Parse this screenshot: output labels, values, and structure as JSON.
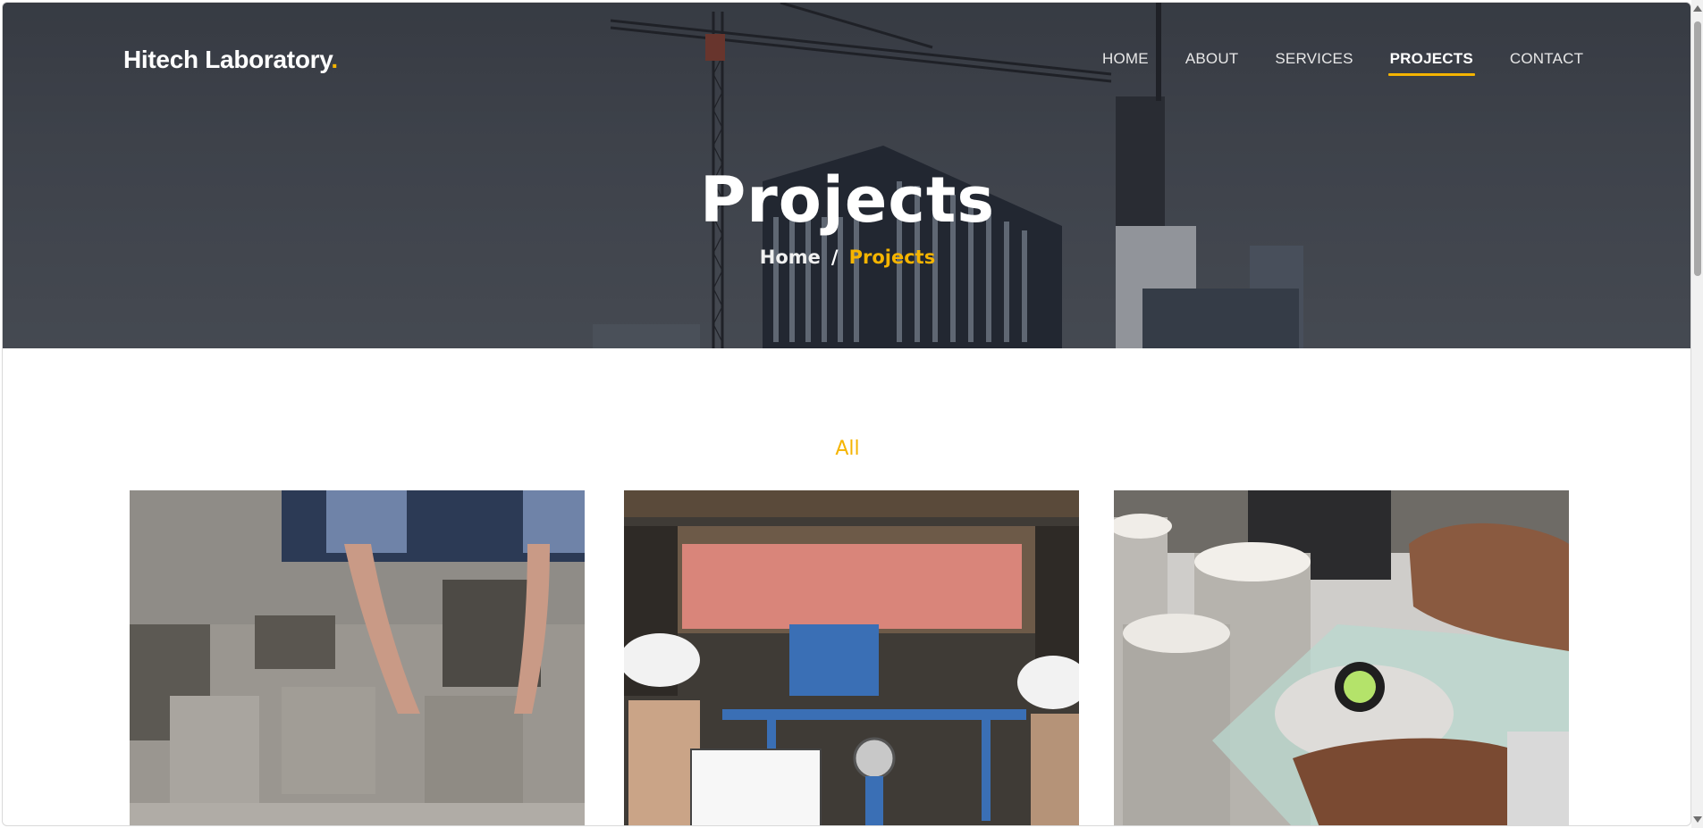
{
  "brand": {
    "name": "Hitech Laboratory",
    "dot": "."
  },
  "nav": {
    "items": [
      {
        "label": "HOME"
      },
      {
        "label": "ABOUT"
      },
      {
        "label": "SERVICES"
      },
      {
        "label": "PROJECTS",
        "active": true
      },
      {
        "label": "CONTACT"
      }
    ]
  },
  "hero": {
    "title": "Projects",
    "breadcrumb": {
      "home": "Home",
      "separator": "/",
      "current": "Projects"
    }
  },
  "filter": {
    "label": "All"
  },
  "gallery": {
    "items": [
      {
        "icon": "concrete-blocks-image"
      },
      {
        "icon": "truck-field-test-image"
      },
      {
        "icon": "cylinder-test-image"
      }
    ]
  },
  "colors": {
    "accent": "#f5b400",
    "hero_overlay": "#3f444c"
  }
}
